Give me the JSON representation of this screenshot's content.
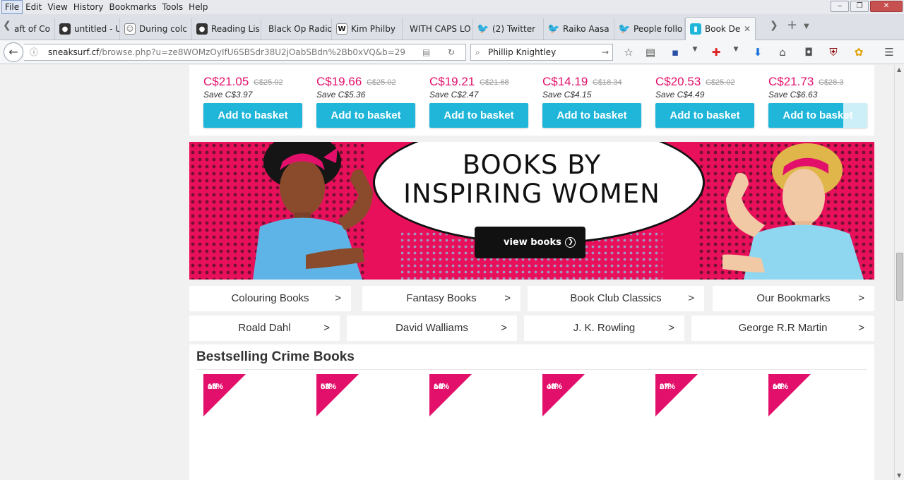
{
  "menubar": {
    "items": [
      "File",
      "Edit",
      "View",
      "History",
      "Bookmarks",
      "Tools",
      "Help"
    ]
  },
  "window": {
    "minimize": "‒",
    "maximize": "❐",
    "close": "✕"
  },
  "tabs": [
    {
      "label": "aft of Co",
      "icon": "dark-favicon"
    },
    {
      "label": "untitled - U",
      "icon": "lock-favicon"
    },
    {
      "label": "During colc",
      "icon": "reddit-favicon"
    },
    {
      "label": "Reading Lis",
      "icon": "lock-favicon"
    },
    {
      "label": "Black Op Radio",
      "icon": ""
    },
    {
      "label": "Kim Philby",
      "icon": "wikipedia-favicon"
    },
    {
      "label": "WITH CAPS LO",
      "icon": ""
    },
    {
      "label": "(2) Twitter",
      "icon": "twitter-favicon"
    },
    {
      "label": "Raiko Aasa",
      "icon": "twitter-favicon"
    },
    {
      "label": "People follo",
      "icon": "twitter-favicon"
    },
    {
      "label": "Book De",
      "icon": "book-favicon"
    }
  ],
  "nav": {
    "url_host": "sneaksurf.cf",
    "url_path": "/browse.php?u=ze8WOMzOyIfU6SBSdr38U2jOabSBdn%2Bb0xVQ&b=29",
    "search_value": "Phillip Knightley"
  },
  "products": [
    {
      "price": "C$21.05",
      "old": "C$25.02",
      "save": "Save C$3.97",
      "button": "Add to basket"
    },
    {
      "price": "C$19.66",
      "old": "C$25.02",
      "save": "Save C$5.36",
      "button": "Add to basket"
    },
    {
      "price": "C$19.21",
      "old": "C$21.68",
      "save": "Save C$2.47",
      "button": "Add to basket"
    },
    {
      "price": "C$14.19",
      "old": "C$18.34",
      "save": "Save C$4.15",
      "button": "Add to basket"
    },
    {
      "price": "C$20.53",
      "old": "C$25.02",
      "save": "Save C$4.49",
      "button": "Add to basket"
    },
    {
      "price": "C$21.73",
      "old": "C$28.3",
      "save": "Save C$6.63",
      "button": "Add to basket"
    }
  ],
  "banner": {
    "title_line1": "BOOKS BY",
    "title_line2": "INSPIRING WOMEN",
    "button": "view books"
  },
  "categories_row1": [
    {
      "label": "Colouring Books",
      "arrow": ">"
    },
    {
      "label": "Fantasy Books",
      "arrow": ">"
    },
    {
      "label": "Book Club Classics",
      "arrow": ">"
    },
    {
      "label": "Our Bookmarks",
      "arrow": ">"
    }
  ],
  "categories_row2": [
    {
      "label": "Roald Dahl",
      "arrow": ">"
    },
    {
      "label": "David Walliams",
      "arrow": ">"
    },
    {
      "label": "J. K. Rowling",
      "arrow": ">"
    },
    {
      "label": "George R.R Martin",
      "arrow": ">"
    }
  ],
  "crime": {
    "title": "Bestselling Crime Books",
    "discounts": [
      {
        "pct": "15%",
        "off": "off"
      },
      {
        "pct": "53%",
        "off": "off"
      },
      {
        "pct": "14%",
        "off": "off"
      },
      {
        "pct": "48%",
        "off": "off"
      },
      {
        "pct": "27%",
        "off": "off"
      },
      {
        "pct": "16%",
        "off": "off"
      }
    ]
  },
  "colors": {
    "accent": "#e3106b",
    "button": "#1fb6d9",
    "banner": "#e8105a"
  }
}
